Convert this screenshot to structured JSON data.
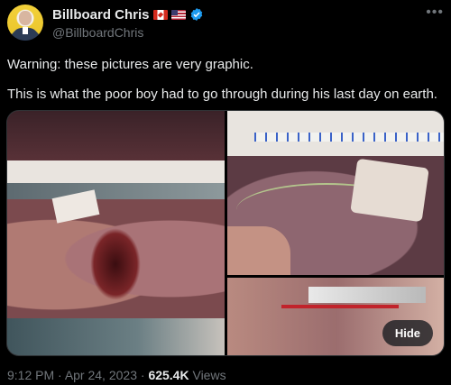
{
  "author": {
    "display_name": "Billboard Chris",
    "handle": "@BillboardChris",
    "flags": [
      "canada-flag-icon",
      "us-flag-icon"
    ],
    "verified_color": "#1d9bf0"
  },
  "tweet": {
    "line1": "Warning: these pictures are very graphic.",
    "line2": "This is what the poor boy had to go through during his last day on earth."
  },
  "media": {
    "count": 3,
    "hide_label": "Hide"
  },
  "meta": {
    "time": "9:12 PM",
    "sep1": " · ",
    "date": "Apr 24, 2023",
    "sep2": " · ",
    "views_count": "625.4K",
    "views_label": " Views"
  },
  "colors": {
    "background": "#000000",
    "primary_text": "#e7e9ea",
    "secondary_text": "#71767b",
    "border": "#2f3336"
  }
}
